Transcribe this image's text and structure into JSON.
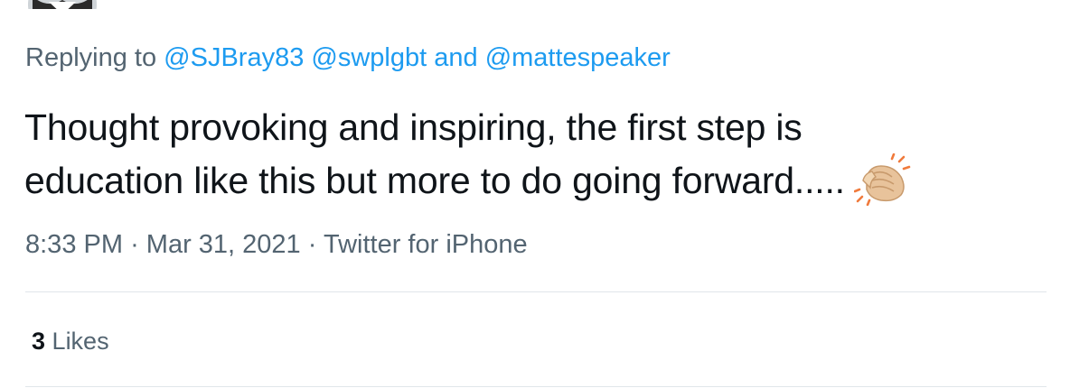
{
  "reply": {
    "prefix": "Replying to",
    "mention_1": "@SJBray83",
    "mention_2": "@swplgbt",
    "connector": "and",
    "mention_3": "@mattespeaker"
  },
  "tweet": {
    "line_1": "Thought provoking and inspiring, the first step is",
    "line_2": "education like this but more to do going forward.....",
    "emoji_icon": "clapping-hands-icon"
  },
  "meta": {
    "time": "8:33 PM",
    "separator": "·",
    "date": "Mar 31, 2021",
    "source": "Twitter for iPhone"
  },
  "engagement": {
    "likes_count": "3",
    "likes_label": "Likes"
  },
  "colors": {
    "link": "#1d9bf0",
    "secondary_text": "#536471",
    "primary_text": "#0f1419",
    "divider": "#e1e6ea"
  }
}
